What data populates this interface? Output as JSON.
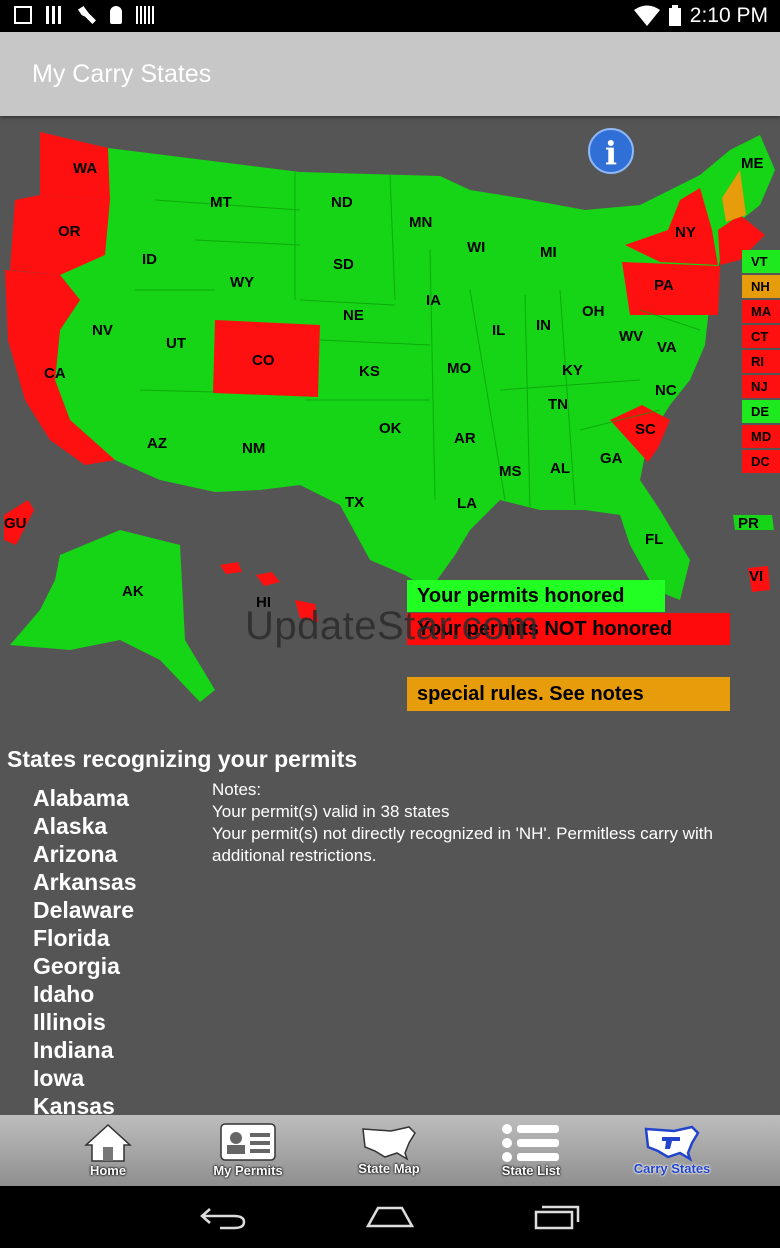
{
  "status": {
    "time": "2:10 PM"
  },
  "app": {
    "title": "My Carry States"
  },
  "map": {
    "legend": {
      "honored": "Your permits honored",
      "not_honored": "Your permits NOT honored",
      "special": "special rules.  See notes"
    },
    "info_icon": "info-icon",
    "colors": {
      "honored": "#1ee81e",
      "not_honored": "#ff1010",
      "special": "#e79c0b",
      "background": "#555555"
    },
    "states": {
      "WA": "WA",
      "OR": "OR",
      "CA": "CA",
      "NV": "NV",
      "ID": "ID",
      "MT": "MT",
      "WY": "WY",
      "UT": "UT",
      "AZ": "AZ",
      "CO": "CO",
      "NM": "NM",
      "ND": "ND",
      "SD": "SD",
      "NE": "NE",
      "KS": "KS",
      "OK": "OK",
      "TX": "TX",
      "MN": "MN",
      "IA": "IA",
      "MO": "MO",
      "AR": "AR",
      "LA": "LA",
      "WI": "WI",
      "IL": "IL",
      "MI": "MI",
      "IN": "IN",
      "OH": "OH",
      "KY": "KY",
      "TN": "TN",
      "MS": "MS",
      "AL": "AL",
      "GA": "GA",
      "FL": "FL",
      "SC": "SC",
      "NC": "NC",
      "VA": "VA",
      "WV": "WV",
      "PA": "PA",
      "NY": "NY",
      "ME": "ME",
      "AK": "AK",
      "HI": "HI",
      "GU": "GU",
      "PR": "PR",
      "VI": "VI"
    },
    "small_states": [
      {
        "code": "VT",
        "status": "honored"
      },
      {
        "code": "NH",
        "status": "special"
      },
      {
        "code": "MA",
        "status": "not"
      },
      {
        "code": "CT",
        "status": "not"
      },
      {
        "code": "RI",
        "status": "not"
      },
      {
        "code": "NJ",
        "status": "not"
      },
      {
        "code": "DE",
        "status": "honored"
      },
      {
        "code": "MD",
        "status": "not"
      },
      {
        "code": "DC",
        "status": "not"
      }
    ]
  },
  "watermark": "UpdateStar.com",
  "recognized": {
    "title": "States recognizing your permits",
    "states": [
      "Alabama",
      "Alaska",
      "Arizona",
      "Arkansas",
      "Delaware",
      "Florida",
      "Georgia",
      "Idaho",
      "Illinois",
      "Indiana",
      "Iowa",
      "Kansas"
    ]
  },
  "notes": {
    "heading": "Notes:",
    "line1": "Your permit(s) valid in 38 states",
    "line2": "Your permit(s) not directly recognized in 'NH'.  Permitless carry with additional restrictions."
  },
  "nav": [
    {
      "label": "Home",
      "icon": "home-icon"
    },
    {
      "label": "My Permits",
      "icon": "id-card-icon"
    },
    {
      "label": "State Map",
      "icon": "us-map-icon"
    },
    {
      "label": "State List",
      "icon": "list-icon"
    },
    {
      "label": "Carry States",
      "icon": "carry-states-icon"
    }
  ]
}
